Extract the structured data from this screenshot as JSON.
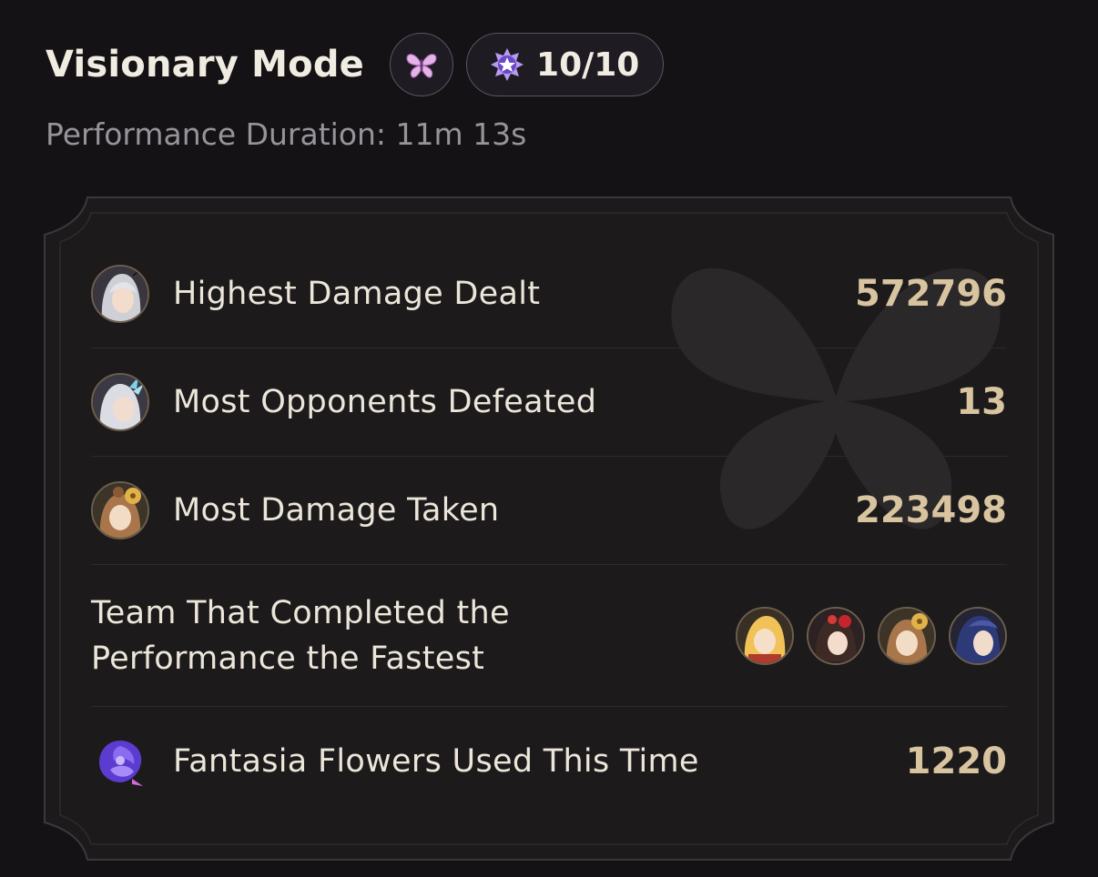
{
  "header": {
    "title": "Visionary Mode",
    "stars_count": "10/10",
    "duration": "Performance Duration: 11m 13s"
  },
  "stats": [
    {
      "label": "Highest Damage Dealt",
      "value": "572796",
      "icon": "character-avatar-white-hair"
    },
    {
      "label": "Most Opponents Defeated",
      "value": "13",
      "icon": "character-avatar-horned-white-hair"
    },
    {
      "label": "Most Damage Taken",
      "value": "223498",
      "icon": "character-avatar-bell-hair"
    }
  ],
  "team": {
    "label_line1": "Team That Completed the",
    "label_line2": "Performance the Fastest",
    "members": [
      "character-avatar-blonde",
      "character-avatar-dark-red",
      "character-avatar-bell-hair",
      "character-avatar-blue-hair"
    ]
  },
  "flowers": {
    "label": "Fantasia Flowers Used This Time",
    "value": "1220",
    "icon": "fantasia-flower-icon"
  },
  "colors": {
    "accent_value": "#d9c4a0",
    "background": "#141214",
    "card": "#1c1a1b"
  }
}
